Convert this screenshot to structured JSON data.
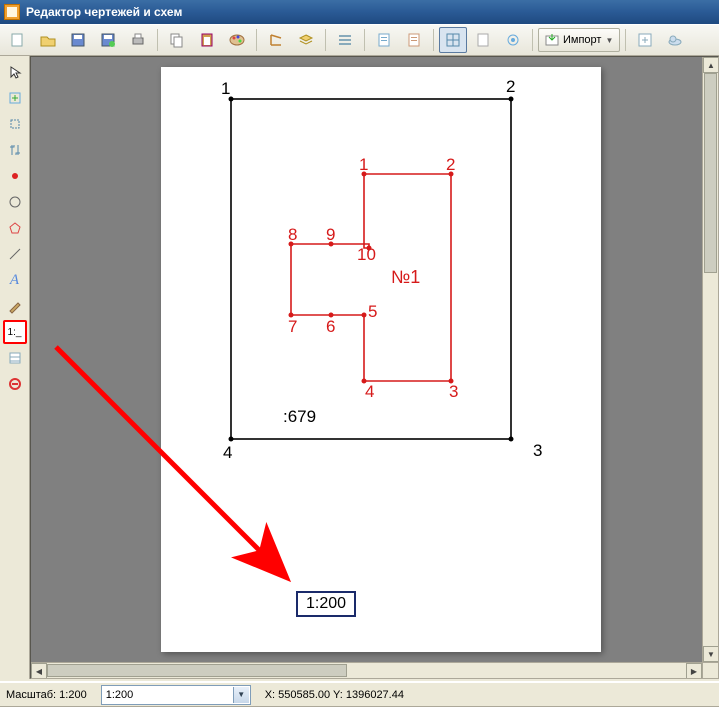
{
  "window": {
    "title": "Редактор чертежей и схем"
  },
  "toolbar": {
    "import_label": "Импорт"
  },
  "drawing": {
    "outer": {
      "labels": {
        "p1": "1",
        "p2": "2",
        "p3": "3",
        "p4": "4"
      }
    },
    "inner": {
      "labels": {
        "p1": "1",
        "p2": "2",
        "p3": "3",
        "p4": "4",
        "p5": "5",
        "p6": "6",
        "p7": "7",
        "p8": "8",
        "p9": "9",
        "p10": "10"
      },
      "name_label": "№1"
    },
    "code_label": ":679",
    "scale_box": "1:200"
  },
  "sidebar": {
    "scale_tool_label": "1:_"
  },
  "status": {
    "scale_label": "Масштаб: 1:200",
    "scale_combo_value": "1:200",
    "coords": "X: 550585.00 Y: 1396027.44"
  }
}
